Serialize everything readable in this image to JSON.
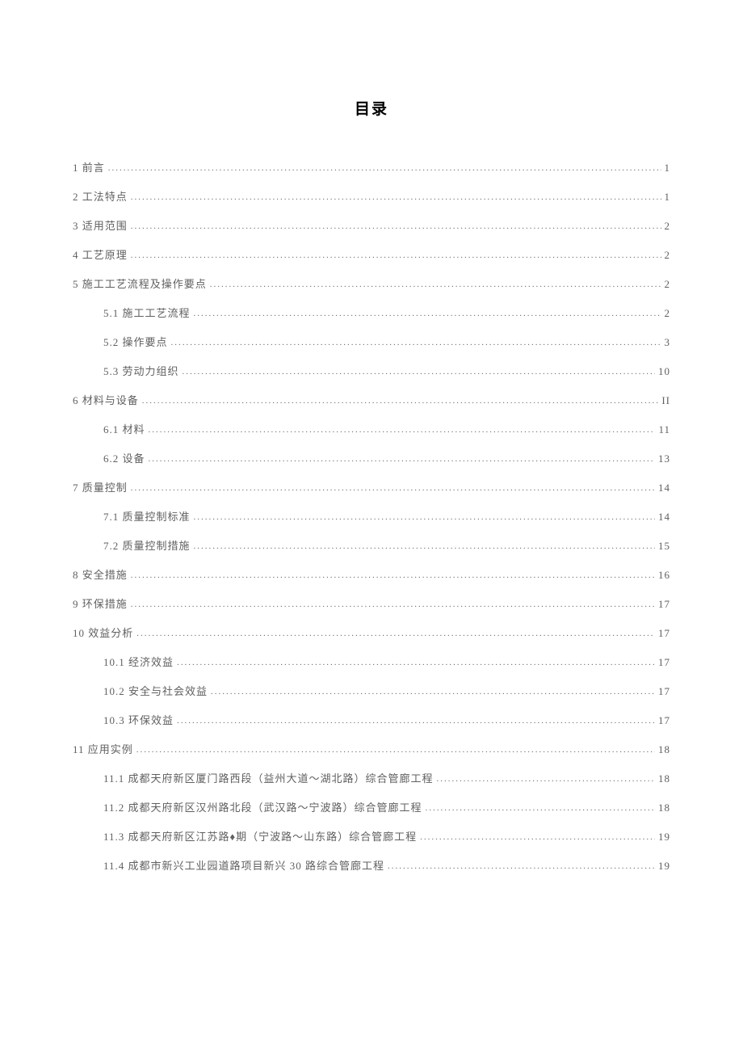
{
  "title": "目录",
  "entries": [
    {
      "level": 1,
      "label": "1 前言",
      "page": "1"
    },
    {
      "level": 1,
      "label": "2 工法特点",
      "page": "1"
    },
    {
      "level": 1,
      "label": "3 适用范围",
      "page": "2"
    },
    {
      "level": 1,
      "label": "4 工艺原理",
      "page": "2"
    },
    {
      "level": 1,
      "label": "5 施工工艺流程及操作要点",
      "page": "2"
    },
    {
      "level": 2,
      "label": "5.1 施工工艺流程",
      "page": "2"
    },
    {
      "level": 2,
      "label": "5.2 操作要点",
      "page": "3"
    },
    {
      "level": 2,
      "label": "5.3 劳动力组织",
      "page": "10"
    },
    {
      "level": 1,
      "label": "6 材料与设备",
      "page": "II"
    },
    {
      "level": 2,
      "label": "6.1 材料",
      "page": "11"
    },
    {
      "level": 2,
      "label": "6.2 设备",
      "page": "13"
    },
    {
      "level": 1,
      "label": "7 质量控制",
      "page": "14"
    },
    {
      "level": 2,
      "label": "7.1 质量控制标准",
      "page": "14"
    },
    {
      "level": 2,
      "label": "7.2 质量控制措施",
      "page": "15"
    },
    {
      "level": 1,
      "label": "8 安全措施",
      "page": "16"
    },
    {
      "level": 1,
      "label": "9 环保措施",
      "page": "17"
    },
    {
      "level": 1,
      "label": "10 效益分析",
      "page": "17"
    },
    {
      "level": 2,
      "label": "10.1 经济效益",
      "page": "17"
    },
    {
      "level": 2,
      "label": "10.2 安全与社会效益",
      "page": "17"
    },
    {
      "level": 2,
      "label": "10.3 环保效益",
      "page": "17"
    },
    {
      "level": 1,
      "label": "11 应用实例",
      "page": "18"
    },
    {
      "level": 2,
      "label": "11.1 成都天府新区厦门路西段（益州大道～湖北路）综合管廊工程",
      "page": "18"
    },
    {
      "level": 2,
      "label": "11.2 成都天府新区汉州路北段（武汉路～宁波路）综合管廊工程",
      "page": "18"
    },
    {
      "level": 2,
      "label": "11.3 成都天府新区江苏路♦期（宁波路～山东路）综合管廊工程",
      "page": "19"
    },
    {
      "level": 2,
      "label": "11.4 成都市新兴工业园道路项目新兴 30 路综合管廊工程",
      "page": "19"
    }
  ]
}
